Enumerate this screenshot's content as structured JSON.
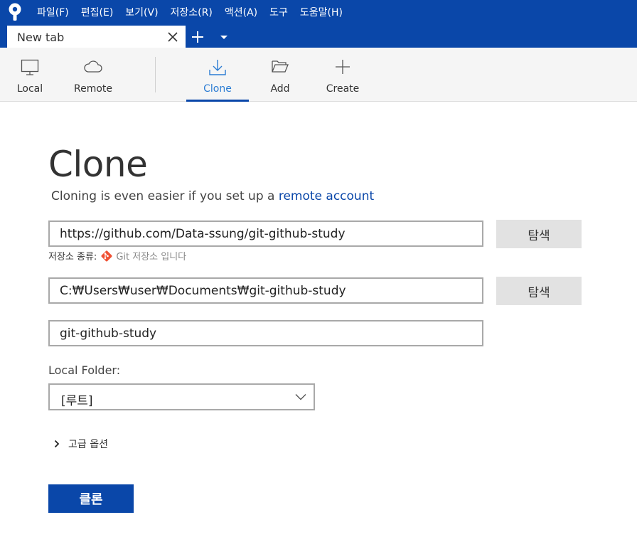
{
  "menubar": {
    "items": [
      "파일(F)",
      "편집(E)",
      "보기(V)",
      "저장소(R)",
      "액션(A)",
      "도구",
      "도움말(H)"
    ]
  },
  "tabs": {
    "active_label": "New tab"
  },
  "toolbar": {
    "local": "Local",
    "remote": "Remote",
    "clone": "Clone",
    "add": "Add",
    "create": "Create"
  },
  "clone": {
    "title": "Clone",
    "subtitle_prefix": "Cloning is even easier if you set up a ",
    "subtitle_link": "remote account",
    "source_url": "https://github.com/Data-ssung/git-github-study",
    "browse_label": "탐색",
    "repo_type_label": "저장소 종류:",
    "repo_type_value": "Git 저장소 입니다",
    "dest_path": "C:₩Users₩user₩Documents₩git-github-study",
    "name": "git-github-study",
    "local_folder_label": "Local Folder:",
    "local_folder_value": "[루트]",
    "advanced_label": "고급 옵션",
    "clone_button": "클론"
  },
  "colors": {
    "brand": "#0a47a9",
    "active_tab_text": "#2b7cd3",
    "git_orange": "#f05033"
  }
}
